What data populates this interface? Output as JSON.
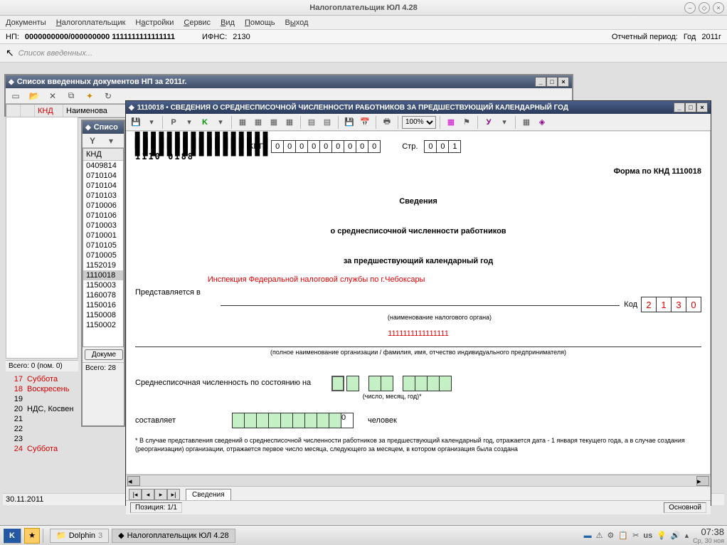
{
  "app_title": "Налогоплательщик ЮЛ 4.28",
  "menu": {
    "documents": "Документы",
    "np": "Налогоплательщик",
    "settings": "Настройки",
    "service": "Сервис",
    "view": "Вид",
    "help": "Помощь",
    "exit": "Выход"
  },
  "info": {
    "np_label": "НП:",
    "np_value": "0000000000/000000000 1111111111111111",
    "ifns_label": "ИФНС:",
    "ifns_value": "2130",
    "period_label": "Отчетный период:",
    "period_type": "Год",
    "period_year": "2011г"
  },
  "toolbar2": {
    "list": "Список введенных..."
  },
  "win1": {
    "title": "Список введенных документов НП за 2011г.",
    "knd": "КНД",
    "name": "Наименова",
    "total": "Всего: 0 (пом. 0)"
  },
  "win2": {
    "title": "Списо",
    "knd": "КНД",
    "items": [
      "0409814",
      "0710104",
      "0710104",
      "0710103",
      "0710006",
      "0710106",
      "0710003",
      "0710001",
      "0710105",
      "0710005",
      "1152019",
      "1110018",
      "1150003",
      "1160078",
      "1150016",
      "1150008",
      "1150002"
    ],
    "selected": "1110018",
    "docbtn": "Докуме",
    "total": "Всего: 28"
  },
  "calendar": [
    {
      "d": "17",
      "t": "Суббота",
      "red": true
    },
    {
      "d": "18",
      "t": "Воскресень",
      "red": true
    },
    {
      "d": "19",
      "t": "",
      "red": false
    },
    {
      "d": "20",
      "t": "НДС, Косвен",
      "red": false
    },
    {
      "d": "21",
      "t": "",
      "red": false
    },
    {
      "d": "22",
      "t": "",
      "red": false
    },
    {
      "d": "23",
      "t": "",
      "red": false
    },
    {
      "d": "24",
      "t": "Суббота",
      "red": true
    }
  ],
  "form": {
    "title": "1110018 • СВЕДЕНИЯ О СРЕДНЕСПИСОЧНОЙ ЧИСЛЕННОСТИ РАБОТНИКОВ ЗА ПРЕДШЕСТВУЮЩИЙ КАЛЕНДАРНЫЙ ГОД",
    "zoom": "100%",
    "barcode_num": "1110 0188",
    "kpp_label": "КПП",
    "kpp": [
      "0",
      "0",
      "0",
      "0",
      "0",
      "0",
      "0",
      "0",
      "0"
    ],
    "page_label": "Стр.",
    "page": [
      "0",
      "0",
      "1"
    ],
    "form_code": "Форма по КНД 1110018",
    "heading1": "Сведения",
    "heading2": "о среднесписочной численности работников",
    "heading3": "за предшествующий календарный год",
    "present_label": "Представляется в",
    "inspection": "Инспекция Федеральной налоговой службы по г.Чебоксары",
    "inspection_caption": "(наименование налогового органа)",
    "code_label": "Код",
    "code": [
      "2",
      "1",
      "3",
      "0"
    ],
    "org": "1111111111111111",
    "org_caption": "(полное наименование организации / фамилия, имя, отчество индивидуального предпринимателя)",
    "avg_label": "Среднесписочная численность по состоянию на",
    "date_caption": "(число, месяц, год)*",
    "consist_label": "составляет",
    "count_value": "0",
    "persons": "человек",
    "footnote": "* В случае представления сведений о среднесписочной численности работников за предшествующий календарный год, отражается дата - 1 января текущего года, а в случае создания (реорганизации) организации, отражается первое число месяца, следующего за месяцем, в котором организация была создана",
    "tab": "Сведения",
    "position": "Позиция: 1/1",
    "mode": "Основной"
  },
  "taskbar": {
    "dolphin": "Dolphin",
    "dolphin_n": "3",
    "app": "Налогоплательщик ЮЛ 4.28",
    "lang": "us",
    "time": "07:38",
    "date": "Ср, 30 ноя"
  },
  "bottom_date": "30.11.2011"
}
